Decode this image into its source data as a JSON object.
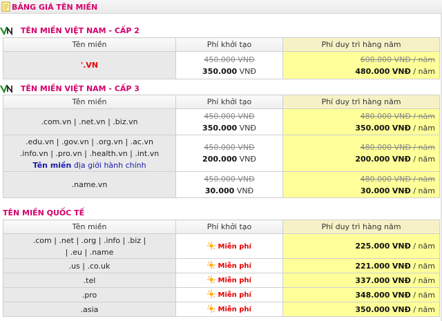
{
  "page": {
    "title": "BẢNG GIÁ TÊN MIỀN"
  },
  "columns": {
    "name": "Tên miền",
    "setup": "Phí khởi tạo",
    "annual": "Phí duy trì hàng năm"
  },
  "unit": {
    "currency": "VNĐ",
    "per_year": "VNĐ / năm"
  },
  "free_text": "Miễn phí",
  "colors": {
    "accent": "#d4006c",
    "annual_bg": "#ffff99",
    "free": "#e30000",
    "admin_link": "#1a1aaa"
  },
  "sections": {
    "vn2": {
      "title": "TÊN MIỀN VIỆT NAM - CẤP 2",
      "rows": [
        {
          "name": "'.VN",
          "setup_old": "450.000",
          "setup_new": "350.000",
          "annual_old": "600.000",
          "annual_new": "480.000"
        }
      ]
    },
    "vn3": {
      "title": "TÊN MIỀN VIỆT NAM - CẤP 3",
      "rows": [
        {
          "name": ".com.vn | .net.vn | .biz.vn",
          "setup_old": "450.000",
          "setup_new": "350.000",
          "annual_old": "480.000",
          "annual_new": "350.000"
        },
        {
          "name_lines": [
            ".edu.vn | .gov.vn | .org.vn | .ac.vn",
            ".info.vn | .pro.vn | .health.vn | .int.vn"
          ],
          "admin_a": "Tên miền",
          "admin_b": "địa giới hành chính",
          "setup_old": "450.000",
          "setup_new": "200.000",
          "annual_old": "480.000",
          "annual_new": "200.000"
        },
        {
          "name": ".name.vn",
          "setup_old": "450.000",
          "setup_new": "30.000",
          "annual_old": "480.000",
          "annual_new": "30.000"
        }
      ]
    },
    "intl": {
      "title": "TÊN MIỀN QUỐC TẾ",
      "rows": [
        {
          "name_lines": [
            ".com | .net | .org | .info | .biz |",
            "| .eu | .name"
          ],
          "annual_new": "225.000"
        },
        {
          "name": ".us | .co.uk",
          "annual_new": "221.000"
        },
        {
          "name": ".tel",
          "annual_new": "337.000"
        },
        {
          "name": ".pro",
          "annual_new": "348.000"
        },
        {
          "name": ".asia",
          "annual_new": "350.000"
        }
      ]
    }
  }
}
